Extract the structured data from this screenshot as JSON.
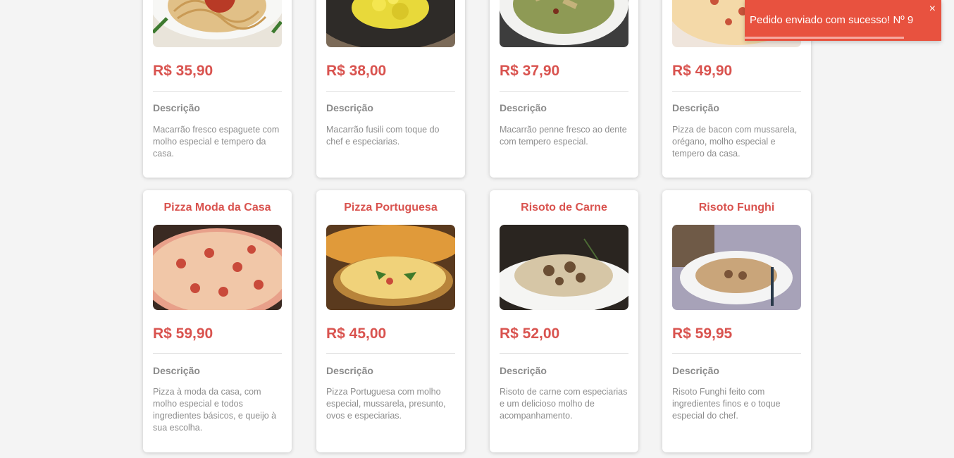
{
  "colors": {
    "accent": "#d9534f",
    "toast_bg": "#e8523f",
    "page_bg": "#f4f4f4"
  },
  "common": {
    "desc_label": "Descrição"
  },
  "row1": [
    {
      "name": "",
      "price": "R$ 35,90",
      "description": "Macarrão fresco espaguete com molho especial e tempero da casa.",
      "image": "spaghetti-image"
    },
    {
      "name": "",
      "price": "R$ 38,00",
      "description": "Macarrão fusili com toque do chef e especiarias.",
      "image": "fusilli-image"
    },
    {
      "name": "",
      "price": "R$ 37,90",
      "description": "Macarrão penne fresco ao dente com tempero especial.",
      "image": "penne-image"
    },
    {
      "name": "",
      "price": "R$ 49,90",
      "description": "Pizza de bacon com mussarela, orégano, molho especial e tempero da casa.",
      "image": "bacon-pizza-image"
    }
  ],
  "row2": [
    {
      "name": "Pizza Moda da Casa",
      "price": "R$ 59,90",
      "description": "Pizza à moda da casa, com molho especial e todos ingredientes básicos, e queijo à sua escolha.",
      "image": "pizza-moda-da-casa-image"
    },
    {
      "name": "Pizza Portuguesa",
      "price": "R$ 45,00",
      "description": "Pizza Portuguesa com molho especial, mussarela, presunto, ovos e especiarias.",
      "image": "pizza-portuguesa-image"
    },
    {
      "name": "Risoto de Carne",
      "price": "R$ 52,00",
      "description": "Risoto de carne com especiarias e um delicioso molho de acompanhamento.",
      "image": "risoto-de-carne-image"
    },
    {
      "name": "Risoto Funghi",
      "price": "R$ 59,95",
      "description": "Risoto Funghi feito com ingredientes finos e o toque especial do chef.",
      "image": "risoto-funghi-image"
    }
  ],
  "toast": {
    "message": "Pedido enviado com sucesso! Nº 9",
    "close": "×",
    "progress_fraction": 0.81
  }
}
